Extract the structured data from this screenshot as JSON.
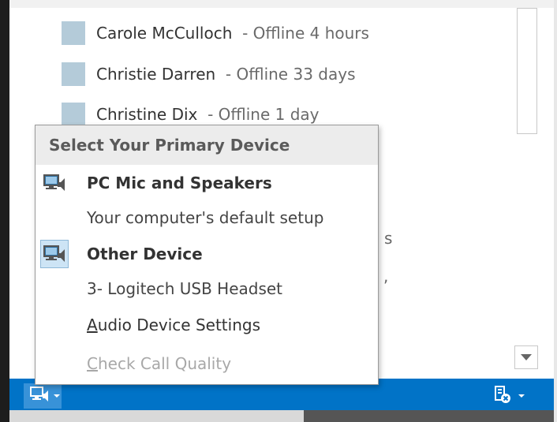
{
  "contacts": [
    {
      "name": "Carole McCulloch",
      "status": "- Offline 4 hours"
    },
    {
      "name": "Christie Darren",
      "status": "- Offline 33 days"
    },
    {
      "name": "Christine Dix",
      "status": "- Offline 1 day"
    }
  ],
  "contact_fragments": [
    "s",
    ","
  ],
  "device_menu": {
    "header": "Select Your Primary Device",
    "devices": [
      {
        "name": "PC Mic and Speakers",
        "detail": "Your computer's default setup",
        "selected": false
      },
      {
        "name": "Other Device",
        "detail": "3- Logitech USB Headset",
        "selected": true
      }
    ],
    "audio_settings": {
      "accel": "A",
      "rest": "udio Device Settings"
    },
    "call_quality": {
      "accel": "C",
      "rest": "heck Call Quality",
      "enabled": false
    }
  },
  "icons": {
    "device_button": "monitor-speaker-icon",
    "right_status": "device-settings-icon",
    "scroll_down": "triangle-down-icon"
  },
  "colors": {
    "statusbar": "#0173c7",
    "presence": "#b4cbd9",
    "menu_header_bg": "#ececec",
    "selected_icon_bg": "#cde4f5"
  }
}
